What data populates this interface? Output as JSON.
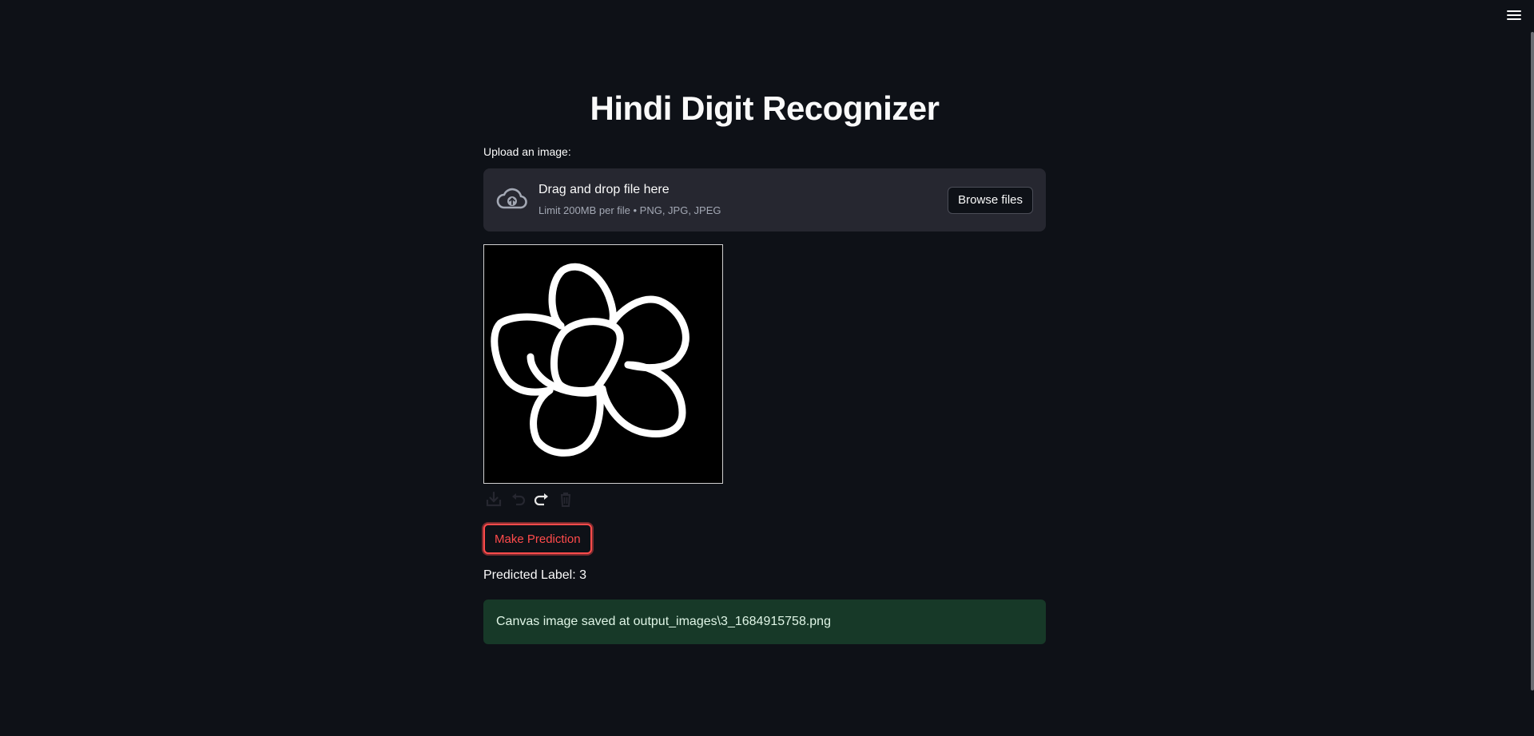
{
  "page": {
    "title": "Hindi Digit Recognizer"
  },
  "uploader": {
    "label": "Upload an image:",
    "drop_title": "Drag and drop file here",
    "drop_subtitle": "Limit 200MB per file • PNG, JPG, JPEG",
    "browse_label": "Browse files",
    "icon": "cloud-upload-icon"
  },
  "canvas": {
    "background_color": "#000000",
    "stroke_color": "#ffffff",
    "toolbar": [
      {
        "icon": "download-icon"
      },
      {
        "icon": "undo-icon"
      },
      {
        "icon": "redo-icon"
      },
      {
        "icon": "trash-icon"
      }
    ]
  },
  "actions": {
    "predict_label": "Make Prediction"
  },
  "result": {
    "predicted_text": "Predicted Label: 3",
    "success_message": "Canvas image saved at output_images\\3_1684915758.png"
  },
  "theme": {
    "background": "#0e1117",
    "primary": "#ff4b4b",
    "success_bg": "#173928"
  }
}
